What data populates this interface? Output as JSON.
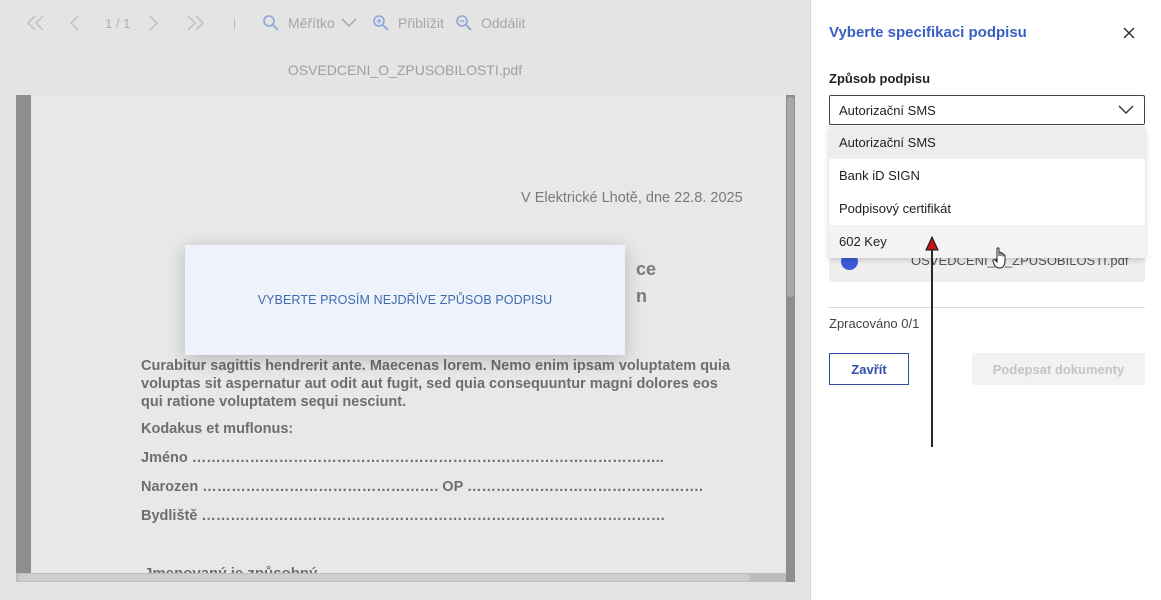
{
  "viewer": {
    "toolbar": {
      "page_indicator": "1 / 1",
      "separator": "|",
      "scale_label": "Měřítko",
      "zoom_in_label": "Přiblížit",
      "zoom_out_label": "Oddálit"
    },
    "filename": "OSVEDCENI_O_ZPUSOBILOSTI.pdf",
    "document": {
      "date_line": "V Elektrické Lhotě, dne 22.8. 2025",
      "heading_line1": "ce",
      "heading_line2": "n",
      "paragraph": "Curabitur sagittis hendrerit ante. Maecenas lorem. Nemo enim ipsam voluptatem quia voluptas sit aspernatur aut odit aut fugit, sed quia consequuntur magni dolores eos qui ratione voluptatem sequi nesciunt.",
      "intro_line": "Kodakus et muflonus:",
      "name_line": "Jméno ……………………………………………………………………………………..",
      "born_line": "Narozen ………………………………………….  OP  ………………………………………….",
      "address_line": "Bydliště ……………………………………………………………………………………",
      "bottom_line": "Jmenovaný je způsobný"
    },
    "modal_message": "VYBERTE PROSÍM NEJDŘÍVE ZPŮSOB PODPISU"
  },
  "panel": {
    "title": "Vyberte specifikaci podpisu",
    "method_label": "Způsob podpisu",
    "selected_method": "Autorizační SMS",
    "options": [
      {
        "label": "Autorizační SMS"
      },
      {
        "label": "Bank iD SIGN"
      },
      {
        "label": "Podpisový certifikát"
      },
      {
        "label": "602 Key"
      }
    ],
    "file_name": "OSVEDCENI_O_ZPUSOBILOSTI.pdf",
    "progress_text": "Zpracováno 0/1",
    "close_button": "Zavřít",
    "sign_button": "Podepsat dokumenty"
  },
  "colors": {
    "accent": "#3a5fc4",
    "file_status": "#3b5bdb",
    "annotation": "#c0141c"
  }
}
